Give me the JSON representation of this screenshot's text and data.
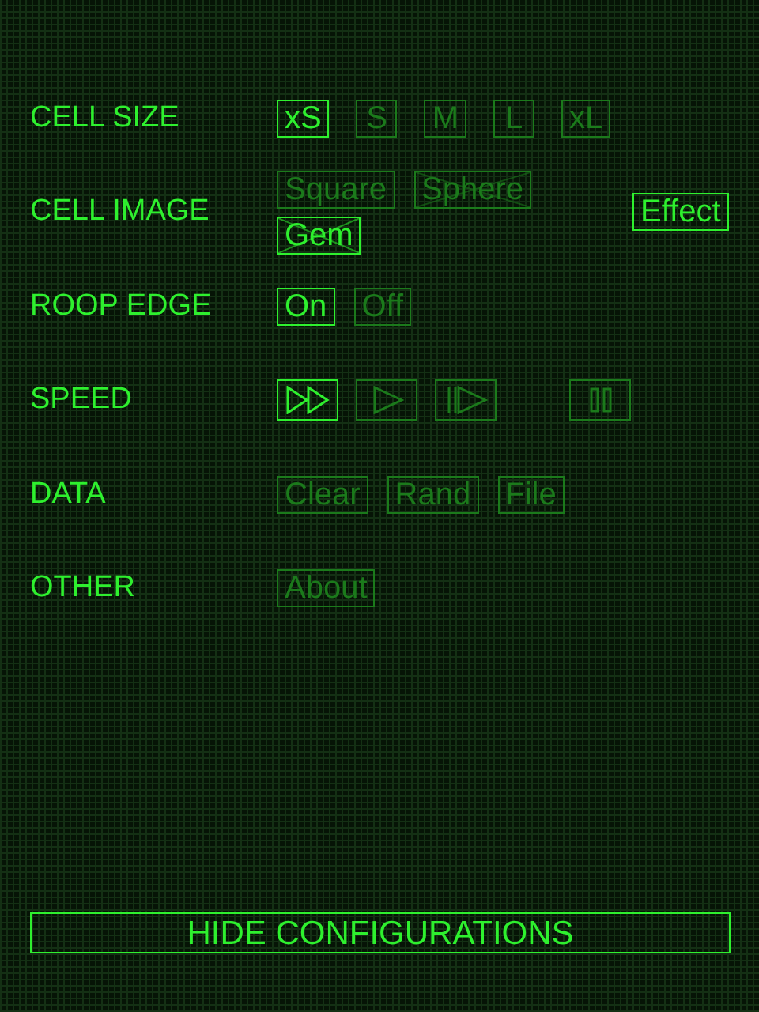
{
  "rows": [
    {
      "label": "CELL SIZE",
      "kind": "text",
      "options": [
        {
          "label": "xS",
          "selected": true
        },
        {
          "label": "S",
          "selected": false
        },
        {
          "label": "M",
          "selected": false
        },
        {
          "label": "L",
          "selected": false
        },
        {
          "label": "xL",
          "selected": false
        }
      ]
    },
    {
      "label": "CELL IMAGE",
      "kind": "text",
      "options": [
        {
          "label": "Square",
          "selected": false,
          "crossed": false
        },
        {
          "label": "Sphere",
          "selected": false,
          "crossed": true
        },
        {
          "label": "Gem",
          "selected": true,
          "crossed": true
        }
      ],
      "extra": {
        "label": "Effect",
        "selected": true
      }
    },
    {
      "label": "ROOP EDGE",
      "kind": "text",
      "options": [
        {
          "label": "On",
          "selected": true
        },
        {
          "label": "Off",
          "selected": false
        }
      ]
    },
    {
      "label": "SPEED",
      "kind": "icon",
      "options": [
        {
          "kind": "fast",
          "selected": true
        },
        {
          "kind": "play",
          "selected": false
        },
        {
          "kind": "step",
          "selected": false
        },
        {
          "kind": "pause",
          "selected": false
        }
      ]
    },
    {
      "label": "DATA",
      "kind": "text",
      "options": [
        {
          "label": "Clear",
          "selected": false
        },
        {
          "label": "Rand",
          "selected": false
        },
        {
          "label": "File",
          "selected": false
        }
      ]
    },
    {
      "label": "OTHER",
      "kind": "text",
      "options": [
        {
          "label": "About",
          "selected": false
        }
      ]
    }
  ],
  "hide_button": {
    "label": "HIDE CONFIGURATIONS"
  }
}
